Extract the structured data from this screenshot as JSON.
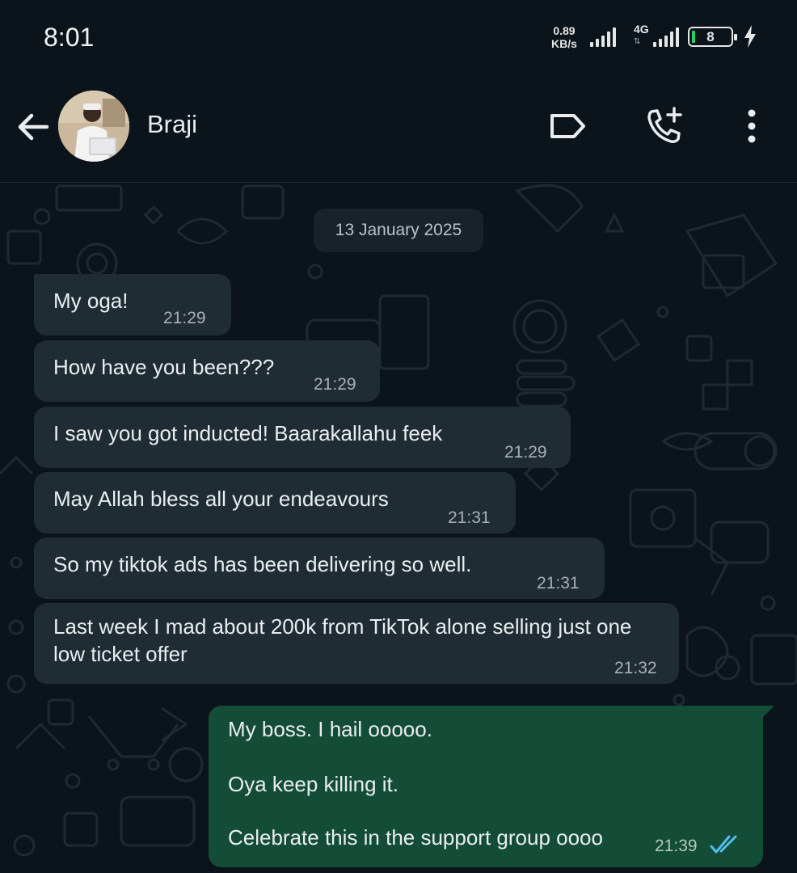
{
  "status_bar": {
    "time": "8:01",
    "net_speed_value": "0.89",
    "net_speed_unit": "KB/s",
    "network_type": "4G",
    "battery_level": "8",
    "battery_color": "#25d366"
  },
  "header": {
    "contact_name": "Braji",
    "icons": [
      "back-arrow-icon",
      "label-icon",
      "add-call-icon",
      "more-vert-icon"
    ]
  },
  "chat": {
    "date_chip": "13 January 2025",
    "incoming": [
      {
        "text": "My oga!",
        "time": "21:29"
      },
      {
        "text": "How have you been???",
        "time": "21:29"
      },
      {
        "text": "I saw you got inducted! Baarakallahu feek",
        "time": "21:29"
      },
      {
        "text": "May Allah bless all your endeavours",
        "time": "21:31"
      },
      {
        "text": "So my tiktok ads has been delivering so well.",
        "time": "21:31"
      },
      {
        "text": "Last week I mad about 200k from TikTok alone selling just one low ticket offer",
        "time": "21:32"
      }
    ],
    "outgoing": {
      "lines": [
        "My boss. I hail ooooo.",
        "Oya keep killing it.",
        "Celebrate this in the support group oooo"
      ],
      "time": "21:39",
      "status": "read"
    }
  },
  "colors": {
    "background": "#0b141a",
    "incoming_bubble": "#202c33",
    "outgoing_bubble": "#144d37",
    "read_ticks": "#53bdeb"
  }
}
